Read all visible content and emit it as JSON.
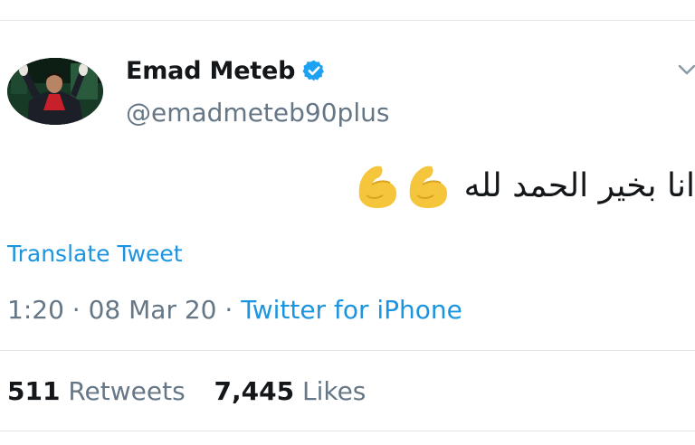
{
  "tweet": {
    "author": {
      "name": "Emad Meteb",
      "handle": "@emadmeteb90plus",
      "verified": true
    },
    "text": "انا بخير الحمد لله",
    "emoji": [
      "flexed-biceps",
      "flexed-biceps"
    ],
    "translate_label": "Translate Tweet",
    "time": "1:20",
    "separator": "·",
    "date": "08 Mar 20",
    "source": "Twitter for iPhone",
    "stats": {
      "retweets_count": "511",
      "retweets_label": "Retweets",
      "likes_count": "7,445",
      "likes_label": "Likes"
    }
  },
  "colors": {
    "link": "#1b95e0",
    "verified": "#1da1f2",
    "muted": "#657786",
    "text": "#14171a",
    "divider": "#e2e6ea"
  },
  "icons": [
    "verified-badge-icon",
    "chevron-down-icon",
    "flexed-biceps-emoji-icon"
  ]
}
